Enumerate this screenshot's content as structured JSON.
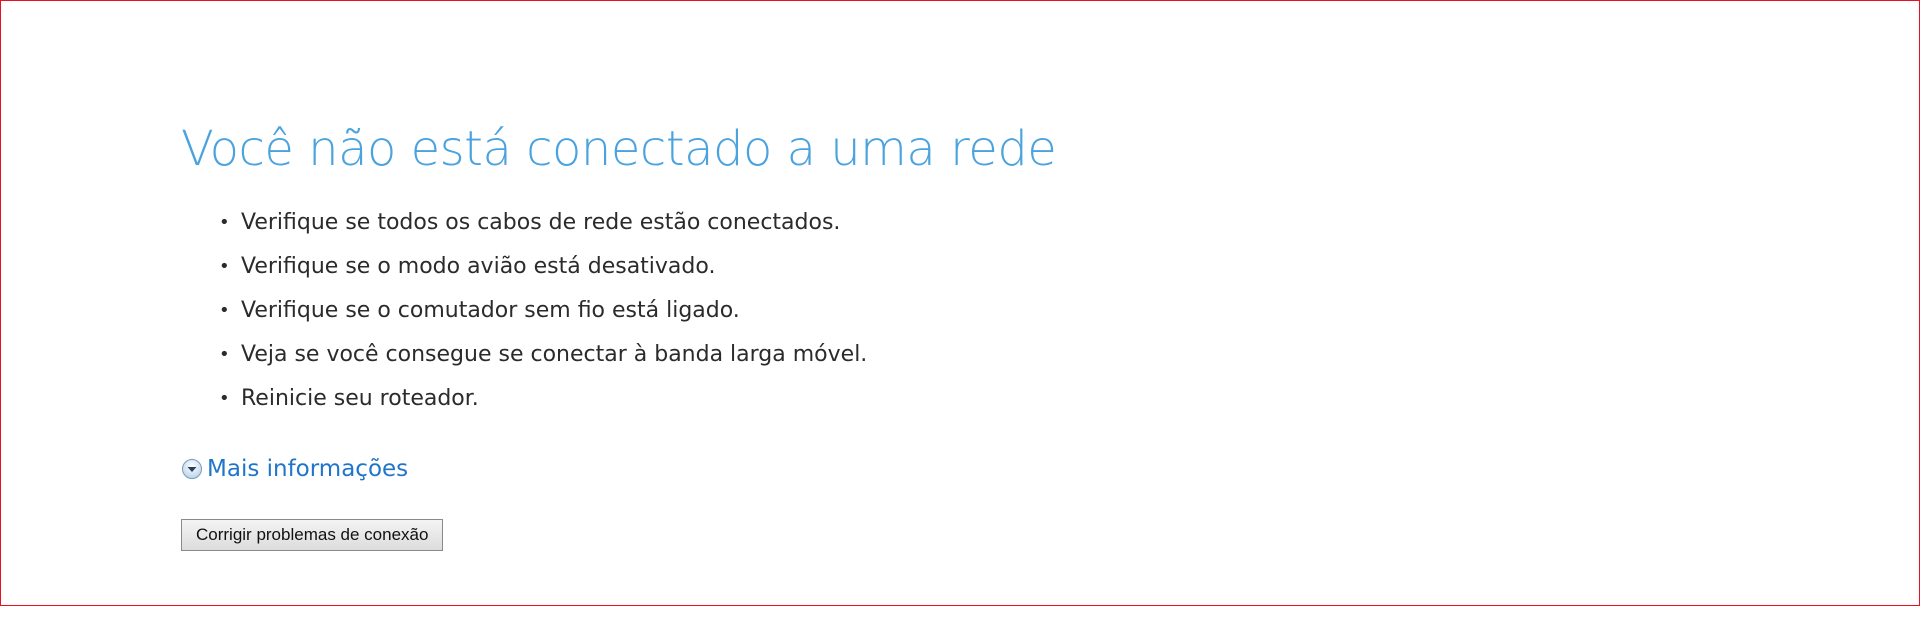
{
  "page": {
    "title": "Você não está conectado a uma rede",
    "tips": [
      "Verifique se todos os cabos de rede estão conectados.",
      "Verifique se o modo avião está desativado.",
      "Verifique se o comutador sem fio está ligado.",
      "Veja se você consegue se conectar à banda larga móvel.",
      "Reinicie seu roteador."
    ],
    "bullet": "•",
    "more_info_label": "Mais informações",
    "more_info_icon": "chevron-down-circle-icon",
    "fix_button_label": "Corrigir problemas de conexão"
  },
  "colors": {
    "title": "#4aa3df",
    "link": "#1f75c9",
    "frame_border": "#e81123",
    "body_text": "#2b2b2b"
  }
}
